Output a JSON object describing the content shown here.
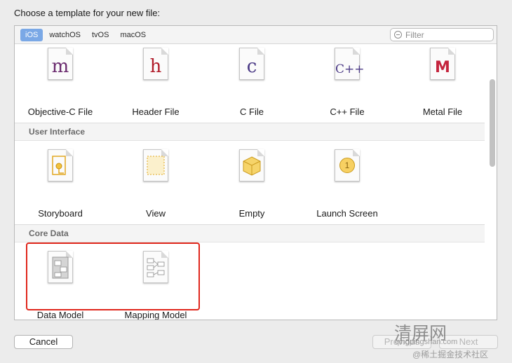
{
  "heading": "Choose a template for your new file:",
  "tabs": [
    {
      "label": "iOS",
      "active": true
    },
    {
      "label": "watchOS",
      "active": false
    },
    {
      "label": "tvOS",
      "active": false
    },
    {
      "label": "macOS",
      "active": false
    }
  ],
  "filter": {
    "placeholder": "Filter"
  },
  "source_templates": [
    {
      "label": "Objective-C File",
      "glyph": "m",
      "color": "#6a2a6e",
      "icon": "objective-c-file-icon"
    },
    {
      "label": "Header File",
      "glyph": "h",
      "color": "#b11d2b",
      "icon": "header-file-icon"
    },
    {
      "label": "C File",
      "glyph": "c",
      "color": "#4b3a86",
      "icon": "c-file-icon"
    },
    {
      "label": "C++ File",
      "glyph": "C++",
      "color": "#4b3a86",
      "icon": "cpp-file-icon"
    },
    {
      "label": "Metal File",
      "glyph": "M",
      "color": "#c4243d",
      "icon": "metal-file-icon"
    }
  ],
  "sections": {
    "user_interface": {
      "title": "User Interface",
      "items": [
        {
          "label": "Storyboard",
          "icon": "storyboard-icon"
        },
        {
          "label": "View",
          "icon": "view-icon"
        },
        {
          "label": "Empty",
          "icon": "empty-icon"
        },
        {
          "label": "Launch Screen",
          "icon": "launch-screen-icon",
          "glyph": "1"
        }
      ]
    },
    "core_data": {
      "title": "Core Data",
      "items": [
        {
          "label": "Data Model",
          "icon": "data-model-icon"
        },
        {
          "label": "Mapping Model",
          "icon": "mapping-model-icon"
        }
      ]
    }
  },
  "buttons": {
    "cancel": "Cancel",
    "previous": "Previous",
    "next": "Next"
  },
  "watermark": {
    "logo_text": "清屏网",
    "url_text": "qingpingshan.com",
    "credit": "@稀土掘金技术社区"
  },
  "colors": {
    "highlight": "#e0261c",
    "selected_tab": "#7aa8e6"
  }
}
